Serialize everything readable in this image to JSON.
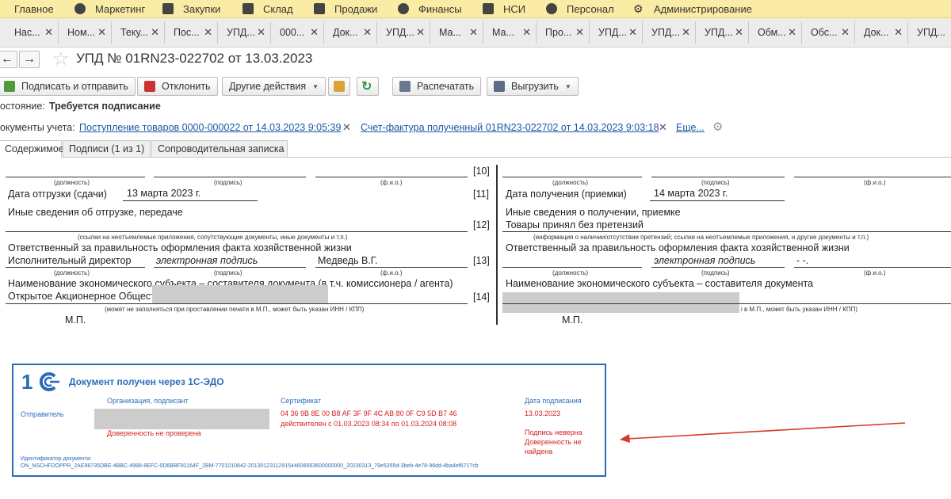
{
  "menu": {
    "items": [
      {
        "label": "Главное",
        "icon": "menu-icon"
      },
      {
        "label": "Маркетинг",
        "icon": "pie-chart-icon"
      },
      {
        "label": "Закупки",
        "icon": "cart-icon"
      },
      {
        "label": "Склад",
        "icon": "warehouse-icon"
      },
      {
        "label": "Продажи",
        "icon": "basket-icon"
      },
      {
        "label": "Финансы",
        "icon": "coin-icon"
      },
      {
        "label": "НСИ",
        "icon": "book-icon"
      },
      {
        "label": "Персонал",
        "icon": "person-icon"
      },
      {
        "label": "Администрирование",
        "icon": "gear-icon"
      }
    ]
  },
  "tabs": [
    "Нас...",
    "Ном...",
    "Теку...",
    "Пос...",
    "УПД...",
    "000...",
    "Док...",
    "УПД...",
    "Ма...",
    "Ма...",
    "Про...",
    "УПД...",
    "УПД...",
    "УПД...",
    "Обм...",
    "Обс...",
    "Док...",
    "УПД..."
  ],
  "document": {
    "title": "УПД № 01RN23-022702 от 13.03.2023"
  },
  "toolbar": {
    "sign_send": "Подписать и отправить",
    "reject": "Отклонить",
    "other_actions": "Другие действия",
    "print": "Распечатать",
    "export": "Выгрузить"
  },
  "status": {
    "label": "остояние:",
    "value": "Требуется подписание"
  },
  "accounting_docs": {
    "label": "окументы учета:",
    "link1": "Поступление товаров 0000-000022 от 14.03.2023 9:05:39",
    "link2": "Счет-фактура полученный 01RN23-022702 от 14.03.2023 9:03:18",
    "more": "Еще..."
  },
  "content_tabs": [
    "Содержимое",
    "Подписи (1 из 1)",
    "Сопроводительная записка"
  ],
  "form": {
    "left": {
      "cap_position": "(должность)",
      "cap_signature": "(подпись)",
      "cap_fio": "(ф.и.о.)",
      "n10": "[10]",
      "ship_date_label": "Дата отгрузки (сдачи)",
      "ship_date_value": "13 марта 2023 г.",
      "n11": "[11]",
      "other_info_label": "Иные сведения об отгрузке, передаче",
      "n12": "[12]",
      "cap_links": "(ссылки на неотъемлемые приложения, сопутствующие документы, иные документы и т.п.)",
      "responsible_label": "Ответственный за правильность оформления факта хозяйственной жизни",
      "resp_position": "Исполнительный директор",
      "resp_signature": "электронная подпись",
      "resp_fio": "Медведь В.Г.",
      "n13": "[13]",
      "entity_label": "Наименование экономического субъекта – составителя документа (в т.ч. комиссионера / агента)",
      "entity_value": "Открытое Акционерное Общество",
      "n14": "[14]",
      "cap_stamp": "(может не заполняться при проставлении печати в М.П., может быть указан ИНН / КПП)",
      "mp": "М.П."
    },
    "right": {
      "cap_position": "(должность)",
      "cap_signature": "(подпись)",
      "cap_fio": "(ф.и.о.)",
      "receive_date_label": "Дата получения (приемки)",
      "receive_date_value": "14 марта 2023 г.",
      "other_info_label": "Иные сведения о получении, приемке",
      "other_info_value": "Товары принял без претензий",
      "cap_claims": "(информация о наличии/отсутствии претензий; ссылки на неотъемлемые приложения, и другие  документы и т.п.)",
      "responsible_label": "Ответственный за правильность оформления факта хозяйственной жизни",
      "resp_signature": "электронная подпись",
      "resp_fio": "- -.",
      "entity_label": "Наименование экономического субъекта – составителя документа",
      "cap_stamp": "і в М.П., может быть указан ИНН / КПП)",
      "mp": "М.П."
    }
  },
  "edo": {
    "logo": "1С",
    "title": "Документ получен через 1С-ЭДО",
    "col_org": "Организация, подписант",
    "col_cert": "Сертификат",
    "col_date": "Дата подписания",
    "sender": "Отправитель",
    "cert_number": "04 36 9B 8E 00 B8 AF 3F 9F 4C AB 80 0F C9 5D B7 46",
    "cert_validity": "действителен с 01.03.2023 08:34 по 01.03.2024 08:08",
    "sign_date": "13.03.2023",
    "power_unchecked": "Доверенность не проверена",
    "sign_invalid": "Подпись неверна",
    "power_not_found_1": "Доверенность не",
    "power_not_found_2": "найдена",
    "doc_id_label": "Идентификатор документа:",
    "doc_id": "ON_NSCHFDOPPR_2AE98735DBE-4BBC-4988-8EFC-0D6BBF91164F_2BM-7701010842-2013012311291544606563600000000_20230313_79e5355d-3beb-4e78-96dd-4ba4ef6717cb"
  },
  "colors": {
    "menu_bg": "#fbeca5",
    "link": "#1b55a5",
    "stamp_blue": "#2b6cb8",
    "error_red": "#d42020",
    "arrow_red": "#d63a2a"
  }
}
